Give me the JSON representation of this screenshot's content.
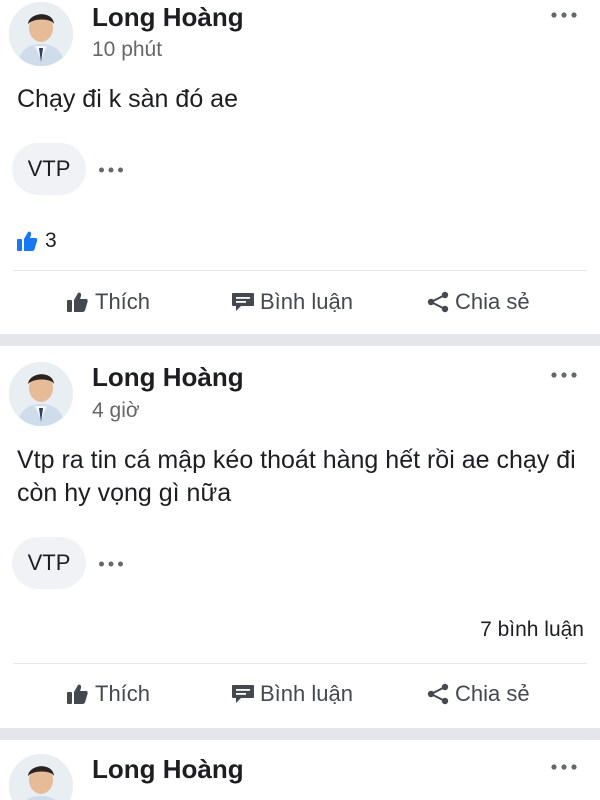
{
  "colors": {
    "separator": "#e4e6eb",
    "chip_background": "#f0f2f5",
    "like_blue": "#1877f2",
    "meta_gray": "#65676b",
    "action_gray": "#444950"
  },
  "actions": {
    "like_label": "Thích",
    "comment_label": "Bình luận",
    "share_label": "Chia sẻ"
  },
  "posts": [
    {
      "author": "Long Hoàng",
      "time": "10 phút",
      "content": "Chạy đi k sàn đó ae",
      "tag": "VTP",
      "reaction_icon": "like-reaction-icon",
      "reaction_count": "3"
    },
    {
      "author": "Long Hoàng",
      "time": "4 giờ",
      "content": "Vtp ra tin cá mập kéo thoát hàng hết rồi ae chạy đi còn hy vọng gì nữa",
      "tag": "VTP",
      "comment_count": "7 bình luận"
    },
    {
      "author": "Long Hoàng"
    }
  ]
}
